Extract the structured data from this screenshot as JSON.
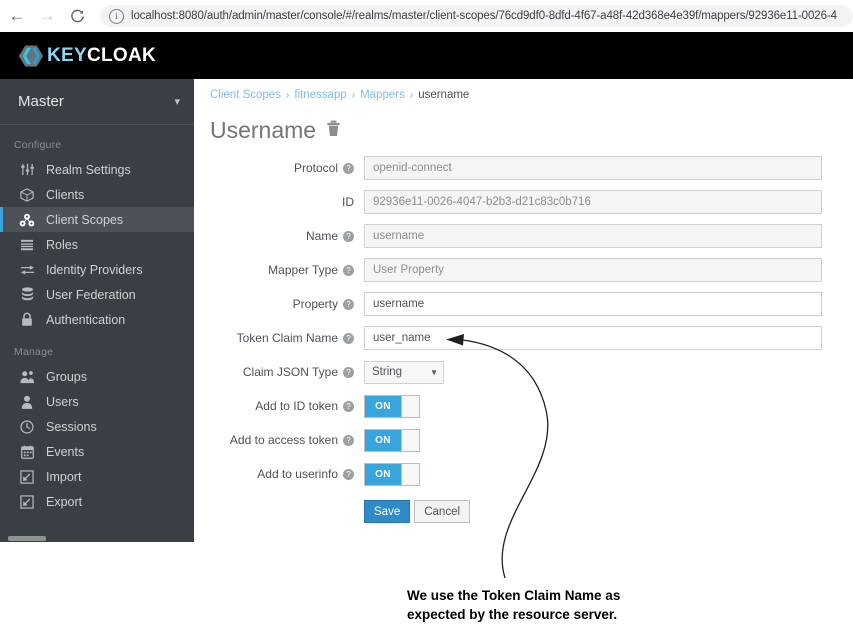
{
  "browser": {
    "back_icon": "arrow-left-icon",
    "forward_icon": "arrow-right-icon",
    "reload_icon": "reload-icon",
    "info_icon": "info-circle-icon",
    "info_glyph": "i",
    "url": "localhost:8080/auth/admin/master/console/#/realms/master/client-scopes/76cd9df0-8dfd-4f67-a48f-42d368e4e39f/mappers/92936e11-0026-4"
  },
  "header": {
    "logo_key": "KEY",
    "logo_cloak": "CLOAK",
    "logo_mark": "keycloak-hexagon-logo"
  },
  "sidebar": {
    "realm": "Master",
    "realm_caret": "⌄",
    "sections": [
      {
        "label": "Configure",
        "items": [
          {
            "label": "Realm Settings",
            "icon": "sliders-icon",
            "active": false
          },
          {
            "label": "Clients",
            "icon": "cube-icon",
            "active": false
          },
          {
            "label": "Client Scopes",
            "icon": "molecule-icon",
            "active": true
          },
          {
            "label": "Roles",
            "icon": "list-icon",
            "active": false
          },
          {
            "label": "Identity Providers",
            "icon": "exchange-arrows-icon",
            "active": false
          },
          {
            "label": "User Federation",
            "icon": "database-icon",
            "active": false
          },
          {
            "label": "Authentication",
            "icon": "lock-icon",
            "active": false
          }
        ]
      },
      {
        "label": "Manage",
        "items": [
          {
            "label": "Groups",
            "icon": "users-group-icon",
            "active": false
          },
          {
            "label": "Users",
            "icon": "user-icon",
            "active": false
          },
          {
            "label": "Sessions",
            "icon": "clock-icon",
            "active": false
          },
          {
            "label": "Events",
            "icon": "calendar-icon",
            "active": false
          },
          {
            "label": "Import",
            "icon": "import-arrow-icon",
            "active": false
          },
          {
            "label": "Export",
            "icon": "export-arrow-icon",
            "active": false
          }
        ]
      }
    ]
  },
  "breadcrumb": {
    "items": [
      {
        "label": "Client Scopes",
        "current": false
      },
      {
        "label": "fitnessapp",
        "current": false
      },
      {
        "label": "Mappers",
        "current": false
      },
      {
        "label": "username",
        "current": true
      }
    ],
    "separator": "›"
  },
  "page": {
    "title": "Username",
    "delete_icon": "trash-icon"
  },
  "form": {
    "help_glyph": "?",
    "fields": [
      {
        "label": "Protocol",
        "value": "openid-connect",
        "type": "text",
        "disabled": true,
        "help": true,
        "name": "protocol"
      },
      {
        "label": "ID",
        "value": "92936e11-0026-4047-b2b3-d21c83c0b716",
        "type": "text",
        "disabled": true,
        "help": false,
        "name": "id"
      },
      {
        "label": "Name",
        "value": "username",
        "type": "text",
        "disabled": true,
        "help": true,
        "name": "name"
      },
      {
        "label": "Mapper Type",
        "value": "User Property",
        "type": "text",
        "disabled": true,
        "help": true,
        "name": "mapper-type"
      },
      {
        "label": "Property",
        "value": "username",
        "type": "text",
        "disabled": false,
        "help": true,
        "name": "property"
      },
      {
        "label": "Token Claim Name",
        "value": "user_name",
        "type": "text",
        "disabled": false,
        "help": true,
        "name": "token-claim-name"
      },
      {
        "label": "Claim JSON Type",
        "value": "String",
        "type": "select",
        "disabled": false,
        "help": true,
        "name": "claim-json-type"
      },
      {
        "label": "Add to ID token",
        "value": "ON",
        "type": "toggle",
        "disabled": false,
        "help": true,
        "name": "add-to-id-token"
      },
      {
        "label": "Add to access token",
        "value": "ON",
        "type": "toggle",
        "disabled": false,
        "help": true,
        "name": "add-to-access-token"
      },
      {
        "label": "Add to userinfo",
        "value": "ON",
        "type": "toggle",
        "disabled": false,
        "help": true,
        "name": "add-to-userinfo"
      }
    ],
    "save_label": "Save",
    "cancel_label": "Cancel"
  },
  "annotation": {
    "caption_line1": "We use the Token Claim Name as",
    "caption_line2": "expected by the resource server."
  },
  "colors": {
    "accent_blue": "#39a5dc",
    "sidebar_bg": "#393f44",
    "sidebar_active_bg": "#4d5258",
    "header_bg": "#000000",
    "save_blue": "#2e8bc8",
    "link_blue": "#7dbce8"
  }
}
